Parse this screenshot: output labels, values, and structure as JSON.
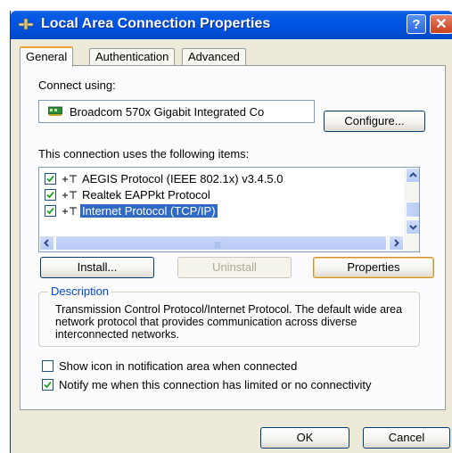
{
  "window": {
    "title": "Local Area Connection Properties",
    "help_label": "?",
    "close_label": "✕"
  },
  "tabs": [
    {
      "label": "General",
      "active": true
    },
    {
      "label": "Authentication",
      "active": false
    },
    {
      "label": "Advanced",
      "active": false
    }
  ],
  "general": {
    "connect_using_label": "Connect using:",
    "adapter_name": "Broadcom 570x Gigabit Integrated Co",
    "configure_label": "Configure...",
    "items_label": "This connection uses the following items:",
    "items": [
      {
        "label": "AEGIS Protocol (IEEE 802.1x) v3.4.5.0",
        "checked": true,
        "selected": false
      },
      {
        "label": "Realtek EAPPkt Protocol",
        "checked": true,
        "selected": false
      },
      {
        "label": "Internet Protocol (TCP/IP)",
        "checked": true,
        "selected": true
      }
    ],
    "install_label": "Install...",
    "uninstall_label": "Uninstall",
    "properties_label": "Properties",
    "description_title": "Description",
    "description_text": "Transmission Control Protocol/Internet Protocol. The default wide area network protocol that provides communication across diverse interconnected networks.",
    "show_icon_label": "Show icon in notification area when connected",
    "show_icon_checked": false,
    "notify_label": "Notify me when this connection has limited or no connectivity",
    "notify_checked": true
  },
  "footer": {
    "ok_label": "OK",
    "cancel_label": "Cancel"
  },
  "colors": {
    "title_bar": "#0055e5",
    "selection": "#316ac5",
    "window_bg": "#ece9d8",
    "focus_border": "#f2a03a"
  }
}
